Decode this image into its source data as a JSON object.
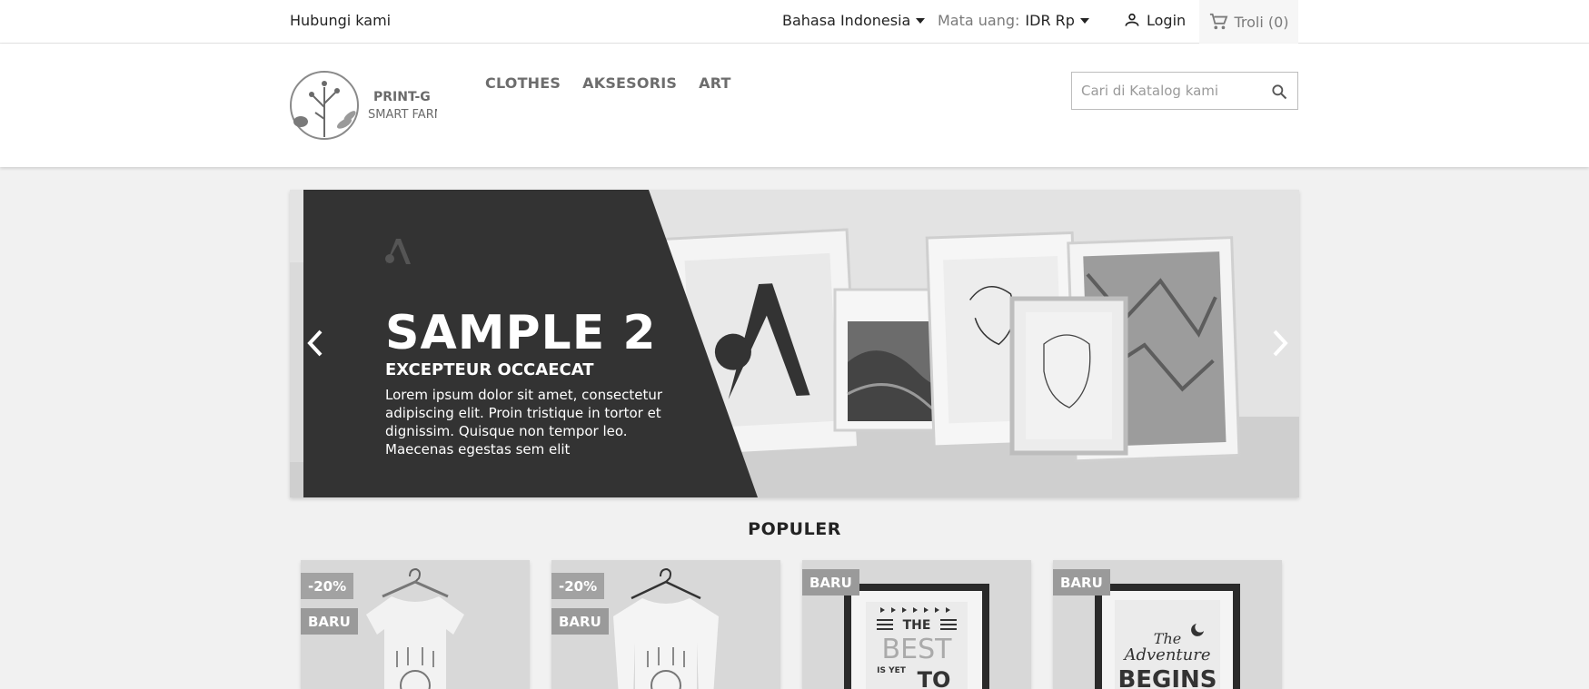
{
  "topbar": {
    "contact": "Hubungi kami",
    "language": "Bahasa Indonesia",
    "currency_label": "Mata uang:",
    "currency_value": "IDR Rp",
    "login": "Login",
    "cart": "Troli (0)"
  },
  "header": {
    "logo_line1": "PRINT-G",
    "logo_line2": "SMART FARM",
    "nav": [
      "CLOTHES",
      "AKSESORIS",
      "ART"
    ],
    "search_placeholder": "Cari di Katalog kami"
  },
  "slider": {
    "title": "SAMPLE 2",
    "subtitle": "EXCEPTEUR OCCAECAT",
    "description": "Lorem ipsum dolor sit amet, consectetur adipiscing elit. Proin tristique in tortor et dignissim. Quisque non tempor leo. Maecenas egestas sem elit"
  },
  "populer": {
    "title": "POPULER",
    "products": [
      {
        "badges": [
          "-20%",
          "BARU"
        ],
        "image": "tshirt"
      },
      {
        "badges": [
          "-20%",
          "BARU"
        ],
        "image": "sweater"
      },
      {
        "badges": [
          "BARU"
        ],
        "image": "poster-best"
      },
      {
        "badges": [
          "BARU"
        ],
        "image": "poster-adventure"
      }
    ]
  },
  "poster_text": {
    "best_1": "THE",
    "best_2": "BEST",
    "best_3": "IS YET",
    "best_4": "TO",
    "adv_1": "The",
    "adv_2": "Adventure",
    "adv_3": "BEGINS"
  },
  "colors": {
    "panel": "#333333",
    "badge": "#9a9a9a",
    "background": "#f1f1f1"
  }
}
